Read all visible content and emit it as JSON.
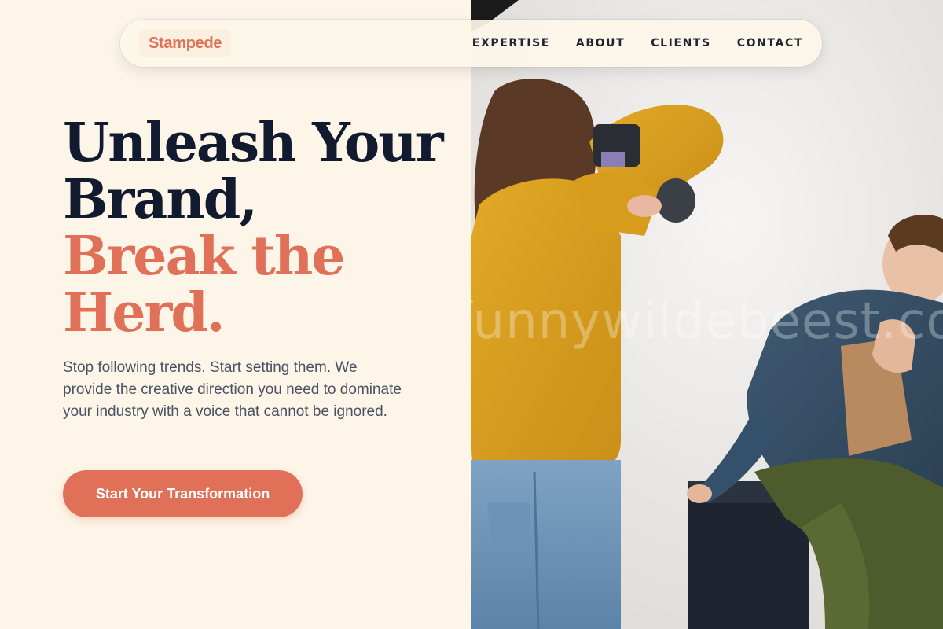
{
  "brand": {
    "logo_text": "Stampede",
    "accent_color": "#e07058",
    "dark_color": "#121a30",
    "background_color": "#fdf5e8"
  },
  "nav": {
    "items": [
      {
        "label": "EXPERTISE"
      },
      {
        "label": "ABOUT"
      },
      {
        "label": "CLIENTS"
      },
      {
        "label": "CONTACT"
      }
    ]
  },
  "hero": {
    "title_lines": [
      "Unleash Your",
      "Brand,"
    ],
    "title_accent_lines": [
      "Break the",
      "Herd."
    ],
    "subtitle": "Stop following trends. Start setting them. We provide the creative direction you need to dominate your industry with a voice that cannot be ignored.",
    "cta_label": "Start Your Transformation"
  },
  "photo": {
    "description_icon": "photo-shoot-image",
    "watermark_text": "funnywildebeest.com"
  }
}
